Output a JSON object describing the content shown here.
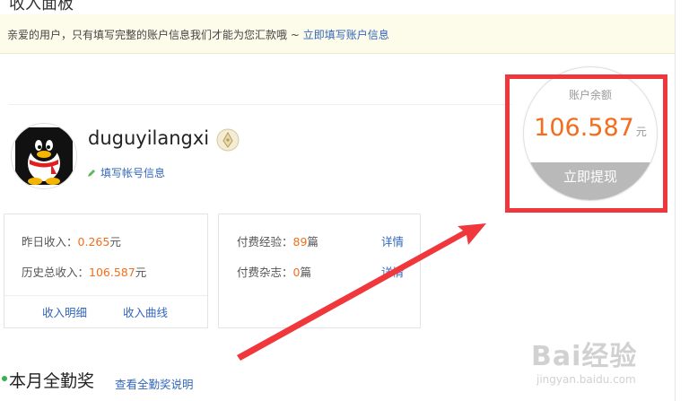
{
  "top_heading_partial": "收入面板",
  "notice": {
    "text": "亲爱的用户，只有填写完整的账户信息我们才能为您汇款哦 ~ ",
    "link": "立即填写账户信息"
  },
  "profile": {
    "username": "duguyilangxi",
    "edit_link": "填写帐号信息"
  },
  "balance": {
    "label": "账户余额",
    "amount": "106.587",
    "unit": "元",
    "withdraw_label": "立即提现"
  },
  "income": {
    "yesterday_label": "昨日收入：",
    "yesterday_value": "0.265",
    "yesterday_unit": "元",
    "total_label": "历史总收入：",
    "total_value": "106.587",
    "total_unit": "元",
    "detail_link": "收入明细",
    "curve_link": "收入曲线"
  },
  "paid": {
    "experience_label": "付费经验：",
    "experience_value": "89",
    "experience_unit": "篇",
    "magazine_label": "付费杂志：",
    "magazine_value": "0",
    "magazine_unit": "篇",
    "detail_link_1": "详情",
    "detail_link_2": "详情"
  },
  "attendance": {
    "title": "本月全勤奖",
    "link": "查看全勤奖说明"
  },
  "watermark": {
    "logo": "Bai经验",
    "url": "jingyan.baidu.com"
  },
  "colors": {
    "accent_orange": "#f36d1c",
    "link_blue": "#3366bb",
    "annotation_red": "#f0383c",
    "notice_bg": "#fdfcea"
  }
}
